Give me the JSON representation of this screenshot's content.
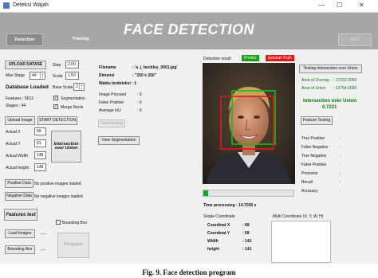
{
  "window": {
    "title": "Deteksi Wajah",
    "minimize": "—",
    "maximize": "☐",
    "close": "✕"
  },
  "header": {
    "tab_detection": "Detection",
    "tab_training": "Training",
    "title": "FACE DETECTION",
    "exit": "EXIT"
  },
  "left": {
    "upload_dataset": "UPLOAD DATASE",
    "max_stage_label": "Max Stage",
    "max_stage_value": "44",
    "database_loaded": "Database Loaded",
    "features": "Features : 5612",
    "stages": "Stages      : 44",
    "step_label": "Step",
    "step_value": "2.00",
    "scale_label": "Scale",
    "scale_value": "1.50",
    "base_scale_label": "Base Scale",
    "base_scale_value": "2",
    "segmentation_label": "Segmentation",
    "merge_rects_label": "Merge Rects",
    "upload_image": "Upload Image",
    "start_detection": "START DETECTION",
    "actual_x_label": "Actual X",
    "actual_x": "49",
    "actual_y_label": "Actual Y",
    "actual_y": "81",
    "actual_width_label": "Actual Width",
    "actual_width": "148",
    "actual_height_label": "Actual height",
    "actual_height": "148",
    "intersection_btn": "Intersection over Union",
    "positive_data": "Positive Data",
    "positive_msg": "No positive images loaded",
    "negative_data": "Negative Data",
    "negative_msg": "No negative images loaded",
    "features_test": "Features test",
    "bounding_box_label": "Bounding Box",
    "load_images": "Load Images",
    "load_images_val": "----",
    "bounding_box_btn": "Bounding Box",
    "bounding_box_val": "----",
    "pengujian": "Pengujian"
  },
  "mid": {
    "filename_label": "Filename",
    "filename_value": ": 'a_j_buckley_0001.jpg'",
    "dimensi_label": "Dimensi",
    "dimensi_value": ": \"250 x 250\"",
    "waktu_label": "Waktu terdeteksi : 1",
    "image_proceed": "Image Proceed",
    "image_proceed_val": ": 0",
    "false_positive": "False Positive",
    "false_positive_val": ": 0",
    "average_iou": "Average IoU",
    "average_iou_val": ": 0",
    "save_testing": "Save testing",
    "view_segmentation": "View Segmentation"
  },
  "result": {
    "label": "Detection result",
    "predict_tag": "Predict",
    "ground_truth_tag": "Ground-Truth",
    "progress_fraction": 0.05,
    "time_processing": "Time processing : 14.7036 s",
    "single_coord": "Single Coordinate",
    "coord_x_label": "Coordinat X",
    "coord_x": ": 68",
    "coord_y_label": "Coordinat Y",
    "coord_y": ": 68",
    "width_label": "Width",
    "width": ": 141",
    "height_label": "height",
    "height": ": 141",
    "multi_coord": "Multi Coordinate (X, Y, W, H)"
  },
  "right": {
    "testing_btn": "Testing intersection over Union",
    "area_overlap_label": "Area of Overlap",
    "area_overlap_val": ": 17152.0000",
    "area_union_label": "Area of Union",
    "area_union_val": ": 23754.0000",
    "iou_title": "Intersection over Union",
    "iou_value": "0.7221",
    "feature_testing": "Feature Testing",
    "true_positive": "True Positive",
    "false_negative": "False Negative",
    "true_negative": "True Negative",
    "false_positive": "False Positive",
    "precision": "Precision",
    "recall": "Recall",
    "accuracy": "Accuracy",
    "colon": ":"
  },
  "caption": "Fig. 9. Face detection program"
}
